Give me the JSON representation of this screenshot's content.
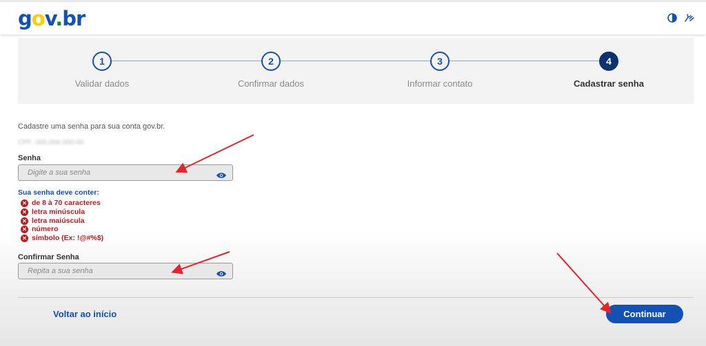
{
  "header": {
    "logo": {
      "g": "g",
      "o": "o",
      "v": "v",
      "dot": ".",
      "br": "br"
    },
    "icons": [
      "contrast-icon",
      "accessibility-hand-icon"
    ]
  },
  "stepper": {
    "steps": [
      {
        "number": "1",
        "label": "Validar dados"
      },
      {
        "number": "2",
        "label": "Confirmar dados"
      },
      {
        "number": "3",
        "label": "Informar contato"
      },
      {
        "number": "4",
        "label": "Cadastrar senha"
      }
    ],
    "active_step": 4
  },
  "form": {
    "intro": "Cadastre uma senha para sua conta gov.br.",
    "cpf_masked": "CPF: 000.000.000-00",
    "password": {
      "label": "Senha",
      "placeholder": "Digite a sua senha"
    },
    "requirements": {
      "title": "Sua senha deve conter:",
      "items": [
        "de 8 à 70 caracteres",
        "letra minúscula",
        "letra maiúscula",
        "número",
        "símbolo (Ex: !@#%$)"
      ]
    },
    "confirm": {
      "label": "Confirmar Senha",
      "placeholder": "Repita a sua senha"
    }
  },
  "footer": {
    "back_label": "Voltar ao início",
    "continue_label": "Continuar"
  },
  "colors": {
    "primary": "#1351b4",
    "primary_dark": "#0c326f",
    "error": "#c3181e",
    "annotation_arrow": "#e8222a"
  }
}
